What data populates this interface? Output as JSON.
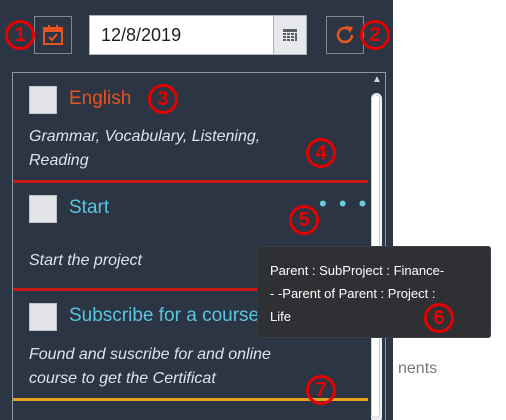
{
  "toolbar": {
    "date_value": "12/8/2019",
    "calendar_icon": "calendar-icon",
    "refresh_icon": "refresh-icon"
  },
  "tasks": [
    {
      "title": "English",
      "title_color": "#e8541f",
      "description": "Grammar, Vocabulary, Listening,\nReading",
      "separator_color": "#c81a1a"
    },
    {
      "title": "Start",
      "title_color": "#5bc4de",
      "description": "Start the project",
      "separator_color": "#c81a1a"
    },
    {
      "title": "Subscribe for a course",
      "title_color": "#5bc4de",
      "description": "Found and suscribe for and online\ncourse to get the Certificat",
      "separator_color": "#e6a21a"
    }
  ],
  "more_menu": "• • •",
  "tooltip": {
    "line1": "Parent : SubProject : Finance-",
    "line2": "- -Parent of Parent : Project :",
    "line3": "Life"
  },
  "background_text": "nents",
  "markers": [
    "1",
    "2",
    "3",
    "4",
    "5",
    "6",
    "7"
  ],
  "colors": {
    "panel": "#2b3544",
    "marker": "#e60000",
    "accent_orange": "#e8541f",
    "accent_cyan": "#5bc4de"
  }
}
